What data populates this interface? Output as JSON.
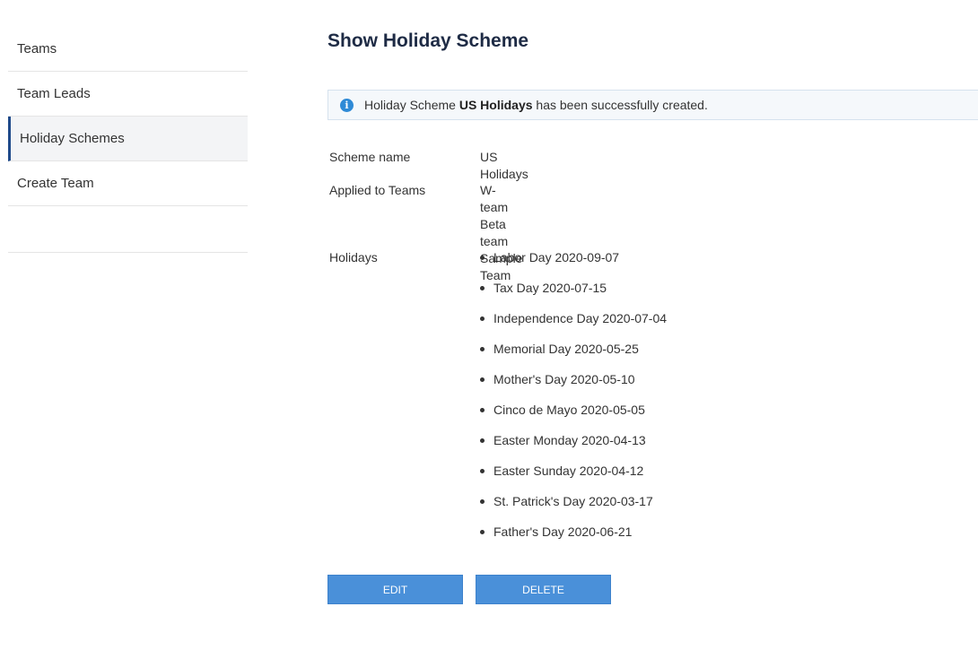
{
  "sidebar": {
    "items": [
      {
        "label": "Teams",
        "active": false
      },
      {
        "label": "Team Leads",
        "active": false
      },
      {
        "label": "Holiday Schemes",
        "active": true
      },
      {
        "label": "Create Team",
        "active": false
      }
    ]
  },
  "main": {
    "title": "Show Holiday Scheme",
    "banner": {
      "icon": "info-icon",
      "prefix": "Holiday Scheme",
      "scheme_name": "US Holidays",
      "suffix": "has been successfully created."
    },
    "fields": {
      "scheme_name_label": "Scheme name",
      "scheme_name_value": "US Holidays",
      "teams_label": "Applied to Teams",
      "teams": [
        "W-team",
        "Beta team",
        "Sample Team"
      ],
      "holidays_label": "Holidays",
      "holidays": [
        "Labor Day 2020-09-07",
        "Tax Day 2020-07-15",
        "Independence Day 2020-07-04",
        "Memorial Day 2020-05-25",
        "Mother's Day 2020-05-10",
        "Cinco de Mayo 2020-05-05",
        "Easter Monday 2020-04-13",
        "Easter Sunday 2020-04-12",
        "St. Patrick's Day 2020-03-17",
        "Father's Day 2020-06-21"
      ]
    },
    "buttons": {
      "edit_label": "EDIT",
      "delete_label": "DELETE"
    }
  },
  "colors": {
    "accent": "#4a90d9",
    "active_border": "#1f4a8a",
    "title": "#1e2b45",
    "info_icon": "#2f8ad6"
  }
}
